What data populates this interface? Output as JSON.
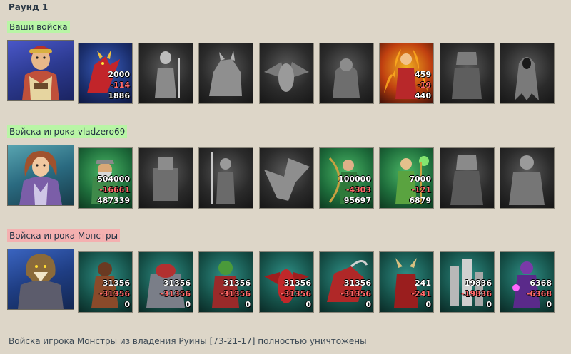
{
  "round_title": "Раунд 1",
  "summary": "Войска игрока Монстры из владения Руины [73-21-17] полностью уничтожены",
  "colors": {
    "green_label": "#b9f5a6",
    "red_label": "#f4b0b0",
    "loss": "#ff6a6a",
    "page_bg": "#ddd6c8"
  },
  "sides": [
    {
      "label": "Ваши войска",
      "units": [
        {
          "icon": "red-dragon-icon",
          "start": "2000",
          "loss": "-114",
          "left": "1886"
        },
        {
          "icon": "skeleton-warrior-icon",
          "start": "",
          "loss": "",
          "left": ""
        },
        {
          "icon": "werewolf-icon",
          "start": "",
          "loss": "",
          "left": ""
        },
        {
          "icon": "gargoyle-icon",
          "start": "",
          "loss": "",
          "left": ""
        },
        {
          "icon": "ghoul-icon",
          "start": "",
          "loss": "",
          "left": ""
        },
        {
          "icon": "fire-monk-icon",
          "start": "459",
          "loss": "-19",
          "left": "440"
        },
        {
          "icon": "armored-knight-icon",
          "start": "",
          "loss": "",
          "left": ""
        },
        {
          "icon": "wraith-icon",
          "start": "",
          "loss": "",
          "left": ""
        }
      ]
    },
    {
      "label": "Войска игрока vladzero69",
      "units": [
        {
          "icon": "dwarf-warrior-icon",
          "start": "504000",
          "loss": "-16661",
          "left": "487339"
        },
        {
          "icon": "iron-golem-icon",
          "start": "",
          "loss": "",
          "left": ""
        },
        {
          "icon": "spearman-icon",
          "start": "",
          "loss": "",
          "left": ""
        },
        {
          "icon": "griffin-icon",
          "start": "",
          "loss": "",
          "left": ""
        },
        {
          "icon": "elf-archer-icon",
          "start": "100000",
          "loss": "-4303",
          "left": "95697"
        },
        {
          "icon": "druid-icon",
          "start": "7000",
          "loss": "-121",
          "left": "6879"
        },
        {
          "icon": "paladin-icon",
          "start": "",
          "loss": "",
          "left": ""
        },
        {
          "icon": "titan-icon",
          "start": "",
          "loss": "",
          "left": ""
        }
      ]
    },
    {
      "label": "Войска игрока Монстры",
      "units": [
        {
          "icon": "lizard-warrior-icon",
          "start": "31356",
          "loss": "-31356",
          "left": "0"
        },
        {
          "icon": "behemoth-icon",
          "start": "31356",
          "loss": "-31356",
          "left": "0"
        },
        {
          "icon": "orc-warrior-icon",
          "start": "31356",
          "loss": "-31356",
          "left": "0"
        },
        {
          "icon": "red-demon-icon",
          "start": "31356",
          "loss": "-31356",
          "left": "0"
        },
        {
          "icon": "scorpion-beast-icon",
          "start": "31356",
          "loss": "-31356",
          "left": "0"
        },
        {
          "icon": "pit-fiend-icon",
          "start": "241",
          "loss": "-241",
          "left": "0"
        },
        {
          "icon": "crystal-tower-icon",
          "start": "19836",
          "loss": "-19836",
          "left": "0"
        },
        {
          "icon": "chaos-mage-icon",
          "start": "6368",
          "loss": "-6368",
          "left": "0"
        }
      ]
    }
  ]
}
